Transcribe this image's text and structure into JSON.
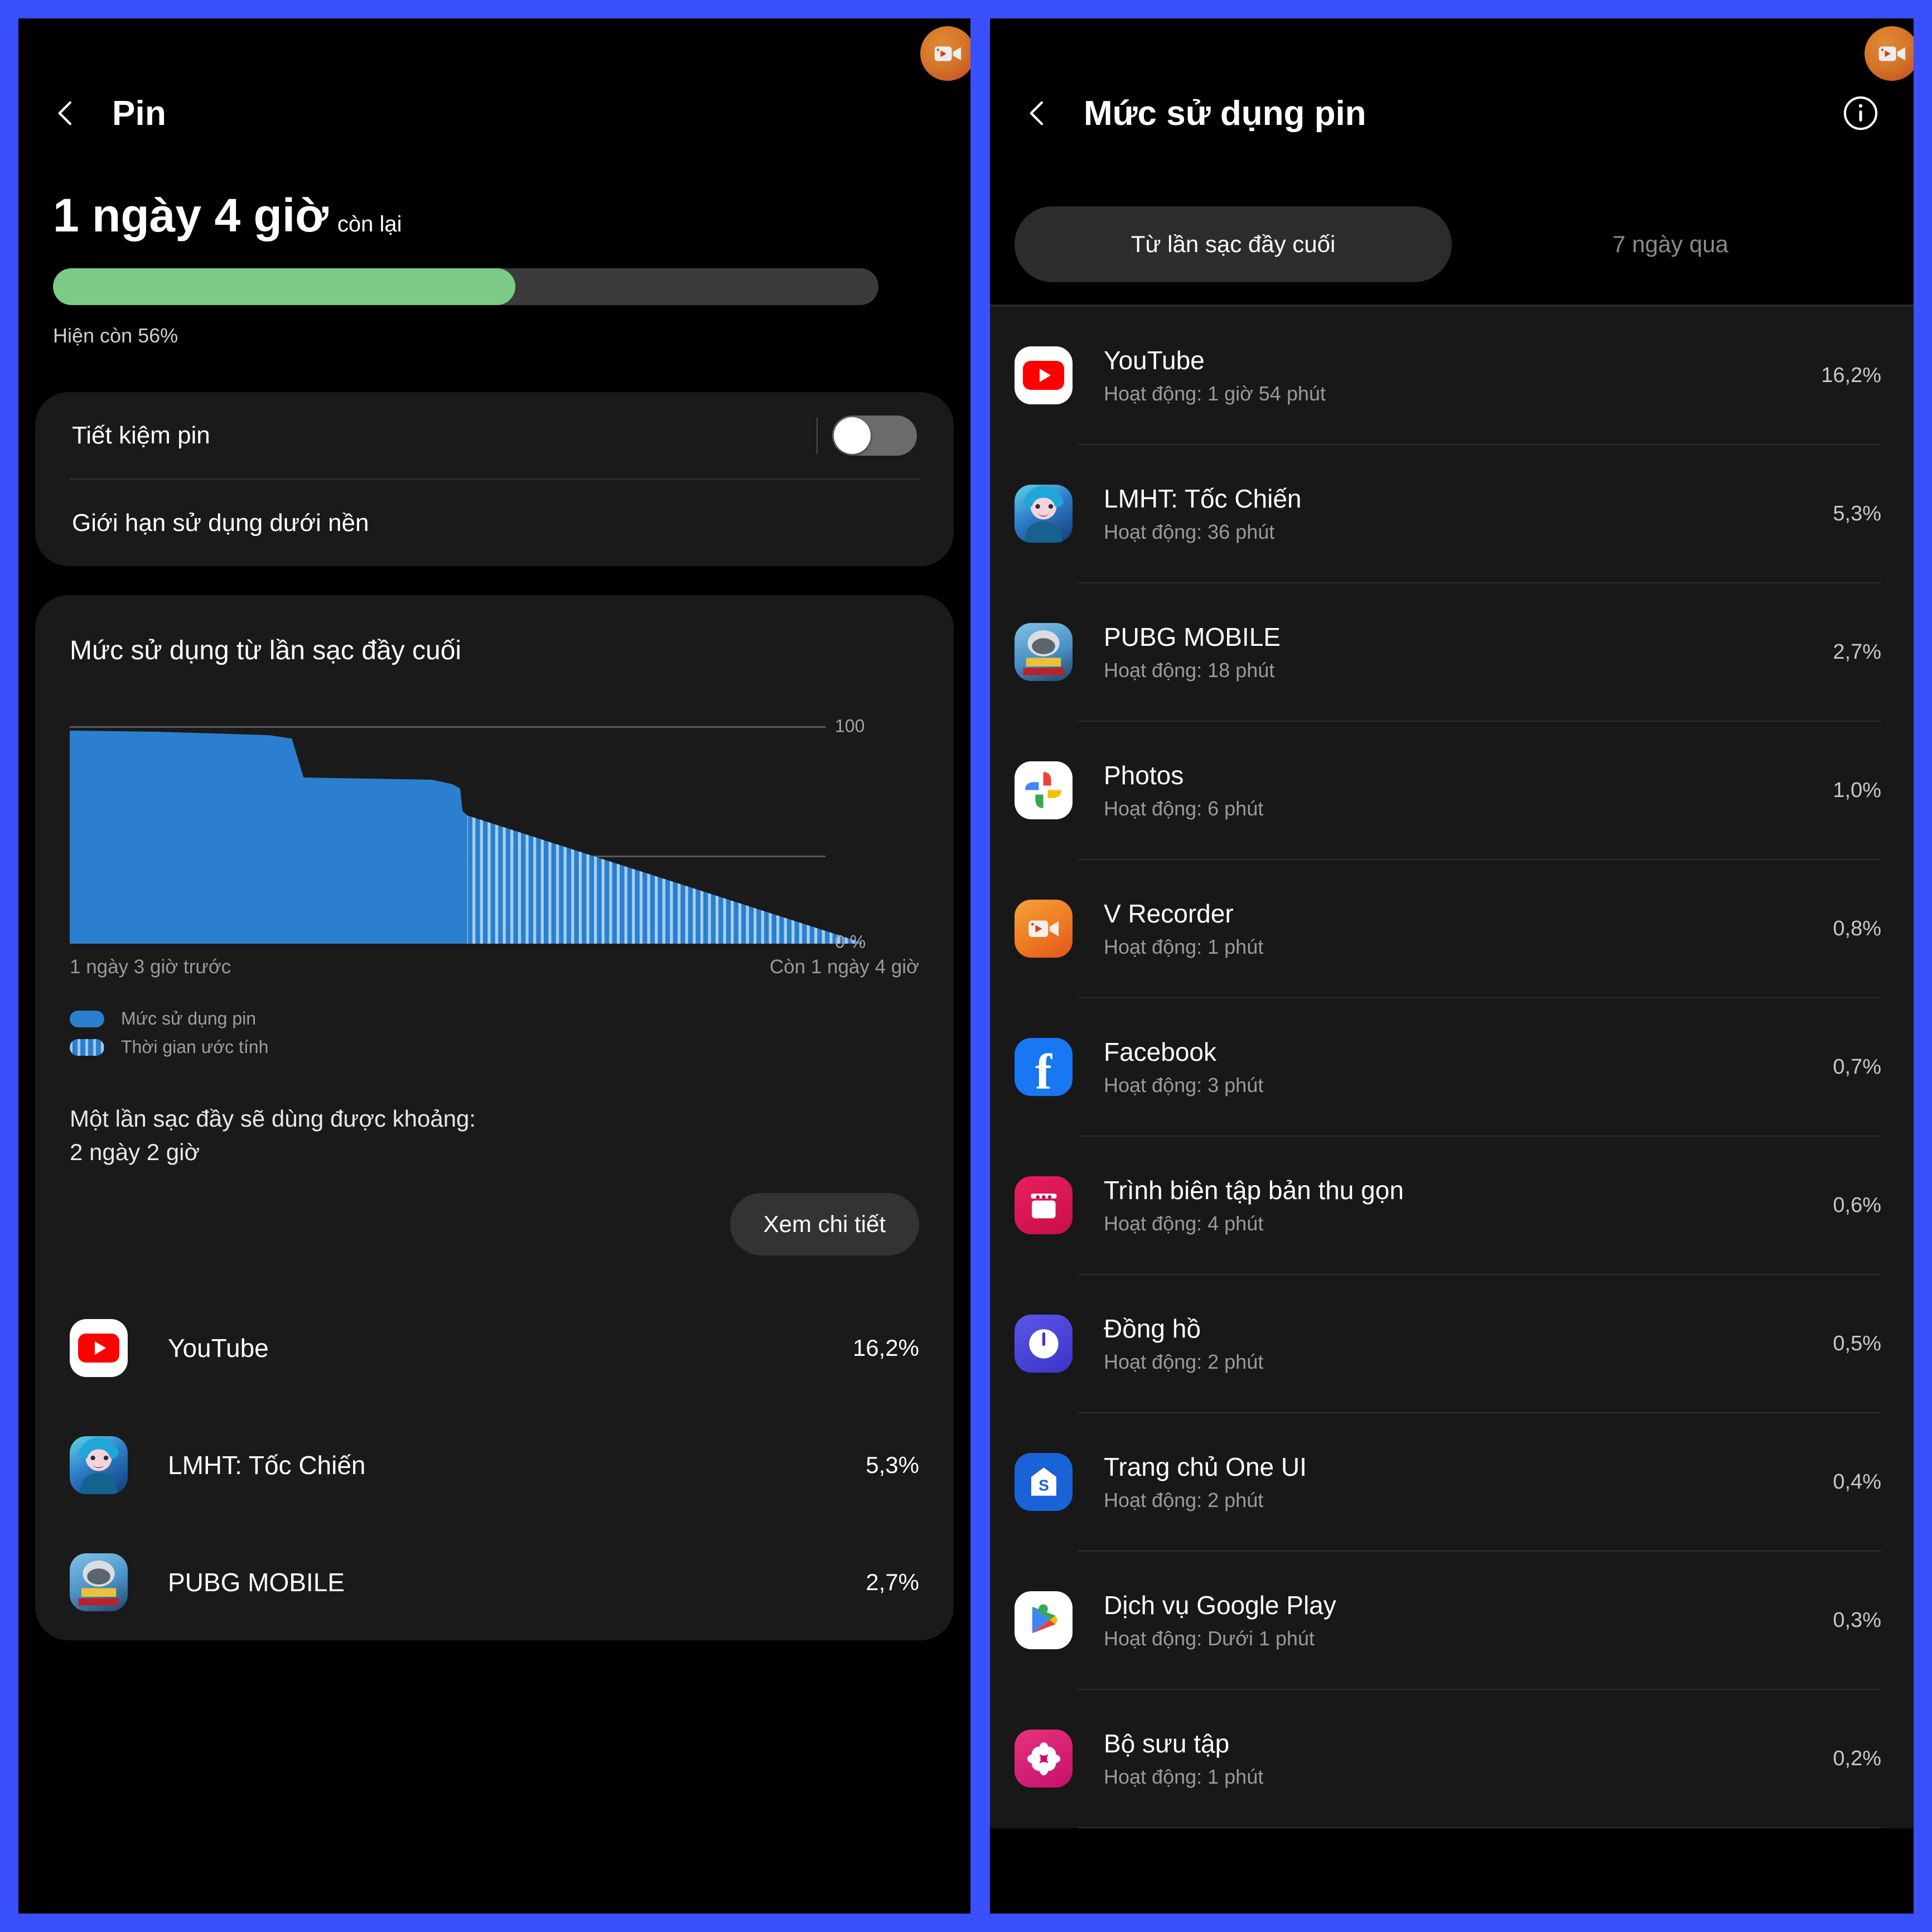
{
  "left": {
    "title": "Pin",
    "back_icon": "back-chevron-icon",
    "hero": {
      "time": "1 ngày 4 giờ",
      "time_suffix": "còn lại",
      "battery_percent": 56,
      "battery_text": "Hiện còn 56%",
      "bar_fill_color": "#7BCB87",
      "bar_track_color": "#3B3B3B"
    },
    "settings": {
      "battery_saver_label": "Tiết kiệm pin",
      "battery_saver_on": false,
      "background_limit_label": "Giới hạn sử dụng dưới nền"
    },
    "usage": {
      "title": "Mức sử dụng từ lần sạc đầy cuối",
      "axis_top": "100",
      "axis_bottom": "0 %",
      "x_start": "1 ngày 3 giờ trước",
      "x_end": "Còn 1 ngày 4 giờ",
      "legend": [
        {
          "label": "Mức sử dụng pin",
          "style": "solid",
          "color": "#2B7FCE"
        },
        {
          "label": "Thời gian ước tính",
          "style": "striped",
          "color": "#2B7FCE"
        }
      ],
      "estimate_label": "Một lần sạc đầy sẽ dùng được khoảng:",
      "estimate_value": "2 ngày 2 giờ",
      "detail_button": "Xem chi tiết"
    },
    "apps": [
      {
        "name": "YouTube",
        "pct": "16,2%",
        "icon": "youtube-icon"
      },
      {
        "name": "LMHT: Tốc Chiến",
        "pct": "5,3%",
        "icon": "lmht-icon"
      },
      {
        "name": "PUBG MOBILE",
        "pct": "2,7%",
        "icon": "pubg-icon"
      }
    ]
  },
  "right": {
    "title": "Mức sử dụng pin",
    "back_icon": "back-chevron-icon",
    "info_icon": "info-icon",
    "tabs": [
      {
        "label": "Từ lần sạc đầy cuối",
        "active": true
      },
      {
        "label": "7 ngày qua",
        "active": false
      }
    ],
    "activity_prefix": "Hoạt động:",
    "apps": [
      {
        "name": "YouTube",
        "sub": "Hoạt động: 1 giờ 54 phút",
        "pct": "16,2%",
        "icon": "youtube-icon"
      },
      {
        "name": "LMHT: Tốc Chiến",
        "sub": "Hoạt động: 36 phút",
        "pct": "5,3%",
        "icon": "lmht-icon"
      },
      {
        "name": "PUBG MOBILE",
        "sub": "Hoạt động: 18 phút",
        "pct": "2,7%",
        "icon": "pubg-icon"
      },
      {
        "name": "Photos",
        "sub": "Hoạt động: 6 phút",
        "pct": "1,0%",
        "icon": "photos-icon"
      },
      {
        "name": "V Recorder",
        "sub": "Hoạt động: 1 phút",
        "pct": "0,8%",
        "icon": "v-recorder-icon"
      },
      {
        "name": "Facebook",
        "sub": "Hoạt động: 3 phút",
        "pct": "0,7%",
        "icon": "facebook-icon"
      },
      {
        "name": "Trình biên tập bản thu gọn",
        "sub": "Hoạt động: 4 phút",
        "pct": "0,6%",
        "icon": "recorder-editor-icon"
      },
      {
        "name": "Đồng hồ",
        "sub": "Hoạt động: 2 phút",
        "pct": "0,5%",
        "icon": "clock-icon"
      },
      {
        "name": "Trang chủ One UI",
        "sub": "Hoạt động: 2 phút",
        "pct": "0,4%",
        "icon": "one-ui-home-icon"
      },
      {
        "name": "Dịch vụ Google Play",
        "sub": "Hoạt động: Dưới 1 phút",
        "pct": "0,3%",
        "icon": "google-play-services-icon"
      },
      {
        "name": "Bộ sưu tập",
        "sub": "Hoạt động: 1 phút",
        "pct": "0,2%",
        "icon": "gallery-icon"
      }
    ]
  },
  "overlay": {
    "recorder_bubble_icon": "video-recorder-icon",
    "bubble_color": "#D4752A"
  },
  "chart_data": {
    "type": "area",
    "title": "Mức sử dụng từ lần sạc đầy cuối",
    "xlabel": "",
    "ylabel": "",
    "ylim": [
      0,
      100
    ],
    "grid": true,
    "legend_position": "below",
    "axis_tick_labels": [
      "100",
      "0 %"
    ],
    "x_range_labels": [
      "1 ngày 3 giờ trước",
      "Còn 1 ngày 4 giờ"
    ],
    "series": [
      {
        "name": "Mức sử dụng pin",
        "style": "solid",
        "color": "#2B7FCE",
        "x": [
          0,
          4,
          10,
          14,
          17,
          18,
          22,
          30,
          33,
          34,
          35,
          36
        ],
        "values": [
          100,
          99,
          98,
          97,
          96,
          82,
          80,
          78,
          77,
          70,
          66,
          56
        ]
      },
      {
        "name": "Thời gian ước tính",
        "style": "striped",
        "color": "#2B7FCE",
        "x": [
          36,
          64
        ],
        "values": [
          56,
          0
        ]
      }
    ],
    "gridlines_y": [
      100,
      41,
      0
    ]
  }
}
